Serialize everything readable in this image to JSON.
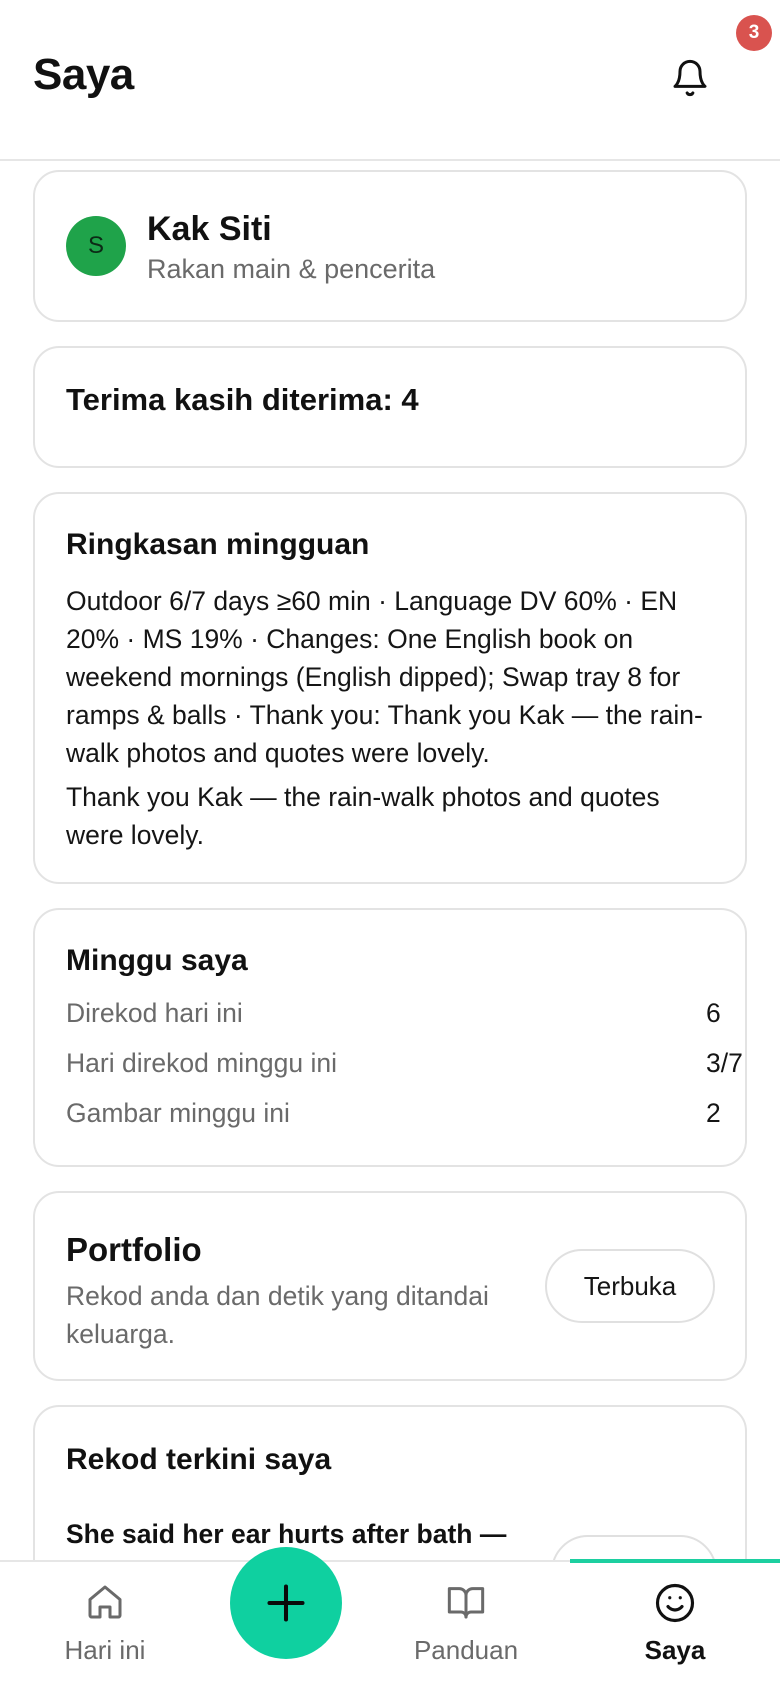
{
  "header": {
    "title": "Saya",
    "notification_count": "3",
    "icons": {
      "notifications": "bell-icon"
    }
  },
  "profile": {
    "avatar_initial": "S",
    "avatar_color": "#1fa34a",
    "name": "Kak Siti",
    "role": "Rakan main & pencerita"
  },
  "thanks": {
    "text": "Terima kasih diterima: 4"
  },
  "weekly_summary": {
    "heading": "Ringkasan mingguan",
    "body": "Outdoor 6/7 days ≥60 min · Language DV 60% · EN 20% · MS 19% · Changes: One English book on weekend mornings (English dipped); Swap tray 8 for ramps & balls · Thank you: Thank you Kak — the rain-walk photos and quotes were lovely.",
    "quote": "Thank you Kak — the rain-walk photos and quotes were lovely."
  },
  "my_week": {
    "heading": "Minggu saya",
    "stats": [
      {
        "label": "Direkod hari ini",
        "value": "6"
      },
      {
        "label": "Hari direkod minggu ini",
        "value": "3/7"
      },
      {
        "label": "Gambar minggu ini",
        "value": "2"
      }
    ]
  },
  "portfolio": {
    "title": "Portfolio",
    "description": "Rekod anda dan detik yang ditandai keluarga.",
    "button_label": "Terbuka"
  },
  "recent": {
    "heading": "Rekod terkini saya",
    "items": [
      {
        "title": "She said her ear hurts after bath —"
      }
    ]
  },
  "bottom_nav": {
    "accent_color": "#0fd0a0",
    "items": [
      {
        "label": "Hari ini",
        "icon": "home-icon",
        "active": false
      },
      {
        "label": "Panduan",
        "icon": "book-icon",
        "active": false
      },
      {
        "label": "Saya",
        "icon": "smiley-icon",
        "active": true
      }
    ],
    "fab_icon": "plus-icon"
  },
  "colors": {
    "badge": "#d9534f",
    "accent": "#1ccfa0"
  }
}
